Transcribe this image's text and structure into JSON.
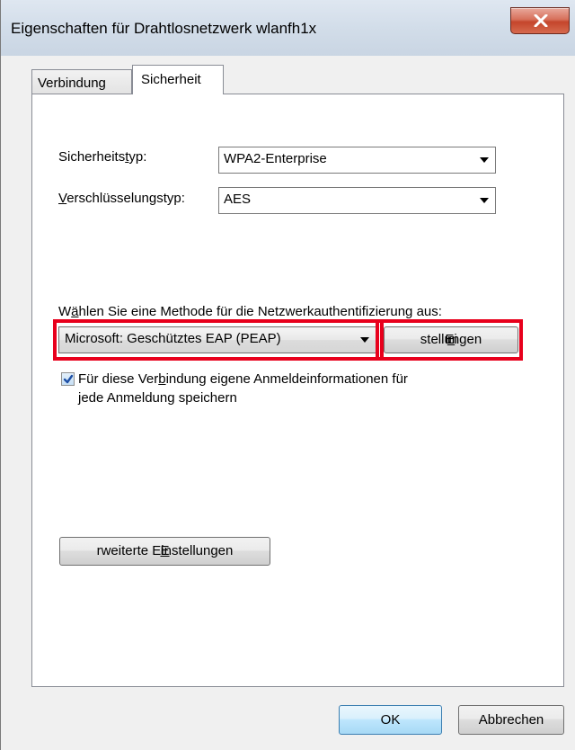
{
  "window": {
    "title": "Eigenschaften für Drahtlosnetzwerk wlanfh1x",
    "close_label": "X"
  },
  "tabs": [
    {
      "label": "Verbindung",
      "selected": false
    },
    {
      "label": "Sicherheit",
      "selected": true
    }
  ],
  "security": {
    "type_label_pre": "Sicherheits",
    "type_label_u": "t",
    "type_label_post": "yp:",
    "type_value": "WPA2-Enterprise",
    "encryption_label_u": "V",
    "encryption_label_post": "erschlüsselungstyp:",
    "encryption_value": "AES"
  },
  "auth": {
    "method_prompt_pre": "W",
    "method_prompt_u": "ä",
    "method_prompt_post": "hlen Sie eine Methode für die Netzwerkauthentifizierung aus:",
    "method_value": "Microsoft: Geschütztes EAP (PEAP)",
    "settings_pre": "Ei",
    "settings_u": "n",
    "settings_post": "stellungen",
    "remember_checked": true,
    "remember_line1_pre": "Für diese Ver",
    "remember_line1_u": "b",
    "remember_line1_post": "indung eigene Anmeldeinformationen für",
    "remember_line2": "jede Anmeldung speichern"
  },
  "advanced": {
    "label_u": "E",
    "label_post": "rweiterte Einstellungen"
  },
  "footer": {
    "ok_label": "OK",
    "cancel_label": "Abbrechen"
  },
  "colors": {
    "highlight": "#e8001c",
    "close_button": "#c4452b"
  }
}
